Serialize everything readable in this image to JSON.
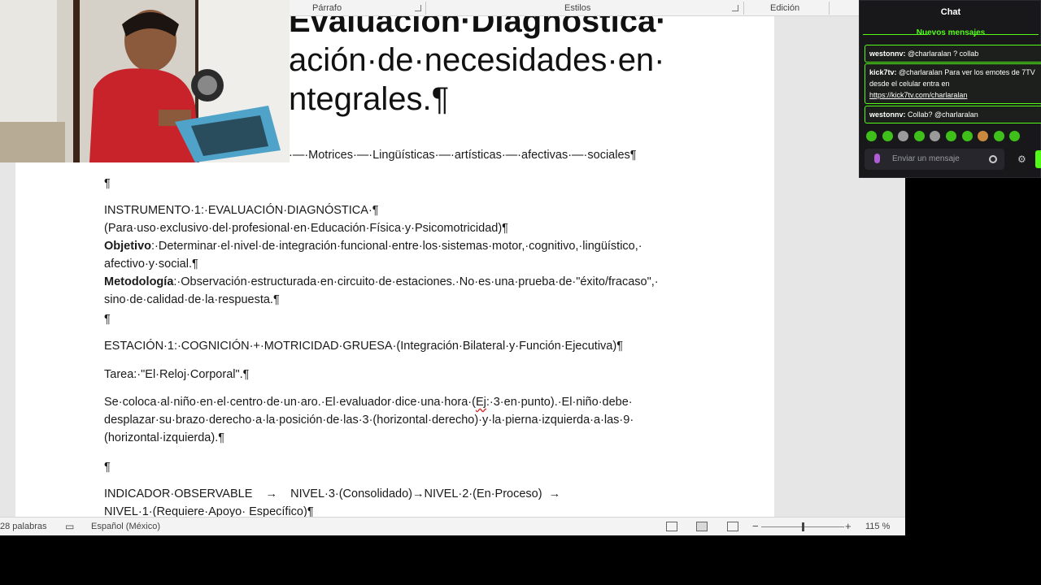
{
  "ribbon": {
    "groups": [
      "Párrafo",
      "Estilos",
      "Edición"
    ]
  },
  "document": {
    "title_lines": [
      "Evaluación·Diagnóstica·",
      "ación·de·necesidades·en·",
      "ntegrales.¶"
    ],
    "paragraphs": {
      "areas": "·—·Motrices·—·Lingüísticas·—·artísticas·—·afectivas·—·sociales¶",
      "blank1": "¶",
      "instrumento": "INSTRUMENTO·1:·EVALUACIÓN·DIAGNÓSTICA·¶",
      "uso": "(Para·uso·exclusivo·del·profesional·en·Educación·Física·y·Psicomotricidad)¶",
      "objetivo_label": "Objetivo",
      "objetivo_text": ":·Determinar·el·nivel·de·integración·funcional·entre·los·sistemas·motor,·cognitivo,·lingüístico,· afectivo·y·social.¶",
      "metodologia_label": "Metodología",
      "metodologia_text": ":·Observación·estructurada·en·circuito·de·estaciones.·No·es·una·prueba·de·\"éxito/fracaso\",· sino·de·calidad·de·la·respuesta.¶",
      "blank2": "¶",
      "estacion": "ESTACIÓN·1:·COGNICIÓN·+·MOTRICIDAD·GRUESA·(Integración·Bilateral·y·Función·Ejecutiva)¶",
      "tarea": "Tarea:·\"El·Reloj·Corporal\".¶",
      "desc_a": "Se·coloca·al·niño·en·el·centro·de·un·aro.·El·evaluador·dice·una·hora·(",
      "desc_ej": "Ej",
      "desc_b": ":·3·en·punto).·El·niño·debe· desplazar·su·brazo·derecho·a·la·posición·de·las·3·(horizontal·derecho)·y·la·pierna·izquierda·a·las·9· (horizontal·izquierda).¶",
      "blank3": "¶",
      "indicador": "INDICADOR·OBSERVABLE    →    NIVEL·3·(Consolidado)→NIVEL·2·(En·Proceso)  →  NIVEL·1·(Requiere·Apoyo· Específico)¶"
    }
  },
  "statusbar": {
    "words": "28 palabras",
    "language": "Español (México)",
    "zoom_minus": "−",
    "zoom_plus": "+",
    "zoom_level": "115 %",
    "zoom_fraction": 0.5
  },
  "chat": {
    "title": "Chat",
    "new_messages": "Nuevos mensajes",
    "messages": [
      {
        "user": "westonnv:",
        "text": " @charlaralan ? collab"
      },
      {
        "user": "kick7tv:",
        "text": " @charlaralan Para ver los emotes de 7TV desde el celular entra en",
        "link": "https://kick7tv.com/charlaralan"
      },
      {
        "user": "westonnv:",
        "text": " Collab? @charlaralan"
      }
    ],
    "input_placeholder": "Enviar un mensaje",
    "settings_icon": "⚙",
    "accent": "#53fc18"
  }
}
